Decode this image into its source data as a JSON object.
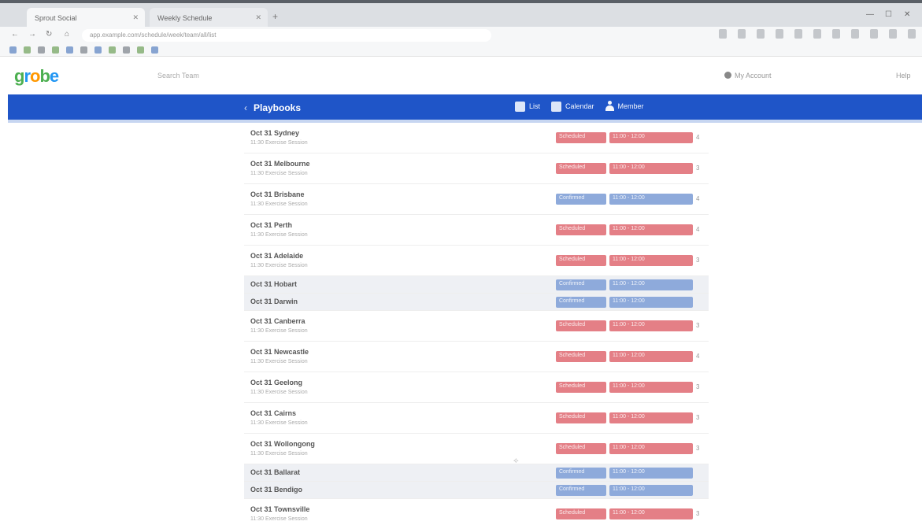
{
  "browser": {
    "tabs": [
      {
        "label": "Sprout Social"
      },
      {
        "label": "Weekly Schedule"
      }
    ],
    "url": "app.example.com/schedule/week/team/all/list"
  },
  "app": {
    "search_placeholder": "Search Team",
    "account_label": "My Account",
    "header_right": "Help"
  },
  "nav": {
    "title": "Playbooks",
    "actions": [
      {
        "label": "List",
        "icon": "list-icon"
      },
      {
        "label": "Calendar",
        "icon": "calendar-icon"
      },
      {
        "label": "Member",
        "icon": "person-icon"
      }
    ]
  },
  "rows": [
    {
      "name": "Oct 31 Sydney",
      "sub": "11:30 Exercise Session",
      "color": "red",
      "seg1": "Scheduled",
      "seg2": "11:00 - 12:00",
      "trail": "4"
    },
    {
      "name": "Oct 31 Melbourne",
      "sub": "11:30 Exercise Session",
      "color": "red",
      "seg1": "Scheduled",
      "seg2": "11:00 - 12:00",
      "trail": "3"
    },
    {
      "name": "Oct 31 Brisbane",
      "sub": "11:30 Exercise Session",
      "color": "blue",
      "seg1": "Confirmed",
      "seg2": "11:00 - 12:00",
      "trail": "4"
    },
    {
      "name": "Oct 31 Perth",
      "sub": "11:30 Exercise Session",
      "color": "red",
      "seg1": "Scheduled",
      "seg2": "11:00 - 12:00",
      "trail": "4"
    },
    {
      "name": "Oct 31 Adelaide",
      "sub": "11:30 Exercise Session",
      "color": "red",
      "seg1": "Scheduled",
      "seg2": "11:00 - 12:00",
      "trail": "3"
    },
    {
      "name": "Oct 31 Hobart",
      "color": "blue",
      "seg1": "Confirmed",
      "seg2": "11:00 - 12:00",
      "trail": ""
    },
    {
      "name": "Oct 31 Darwin",
      "color": "blue",
      "seg1": "Confirmed",
      "seg2": "11:00 - 12:00",
      "trail": ""
    },
    {
      "name": "Oct 31 Canberra",
      "sub": "11:30 Exercise Session",
      "color": "red",
      "seg1": "Scheduled",
      "seg2": "11:00 - 12:00",
      "trail": "3"
    },
    {
      "name": "Oct 31 Newcastle",
      "sub": "11:30 Exercise Session",
      "color": "red",
      "seg1": "Scheduled",
      "seg2": "11:00 - 12:00",
      "trail": "4"
    },
    {
      "name": "Oct 31 Geelong",
      "sub": "11:30 Exercise Session",
      "color": "red",
      "seg1": "Scheduled",
      "seg2": "11:00 - 12:00",
      "trail": "3"
    },
    {
      "name": "Oct 31 Cairns",
      "sub": "11:30 Exercise Session",
      "color": "red",
      "seg1": "Scheduled",
      "seg2": "11:00 - 12:00",
      "trail": "3"
    },
    {
      "name": "Oct 31 Wollongong",
      "sub": "11:30 Exercise Session",
      "color": "red",
      "seg1": "Scheduled",
      "seg2": "11:00 - 12:00",
      "trail": "3"
    },
    {
      "name": "Oct 31 Ballarat",
      "color": "blue",
      "seg1": "Confirmed",
      "seg2": "11:00 - 12:00",
      "trail": ""
    },
    {
      "name": "Oct 31 Bendigo",
      "color": "blue",
      "seg1": "Confirmed",
      "seg2": "11:00 - 12:00",
      "trail": ""
    },
    {
      "name": "Oct 31 Townsville",
      "sub": "11:30 Exercise Session",
      "color": "red",
      "seg1": "Scheduled",
      "seg2": "11:00 - 12:00",
      "trail": "3"
    }
  ],
  "colors": {
    "nav_blue": "#1f55c8",
    "status_red": "#e47f86",
    "status_blue": "#8eaadb"
  }
}
